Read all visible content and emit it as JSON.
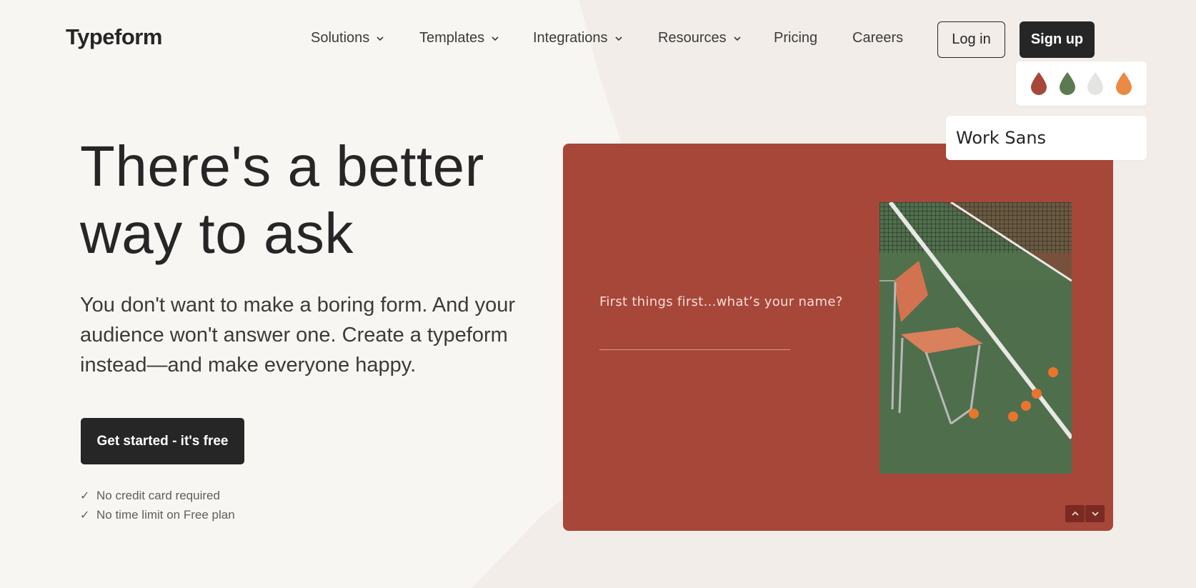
{
  "header": {
    "logo": "Typeform",
    "nav": [
      {
        "label": "Solutions",
        "dropdown": true
      },
      {
        "label": "Templates",
        "dropdown": true
      },
      {
        "label": "Integrations",
        "dropdown": true
      },
      {
        "label": "Resources",
        "dropdown": true
      },
      {
        "label": "Pricing",
        "dropdown": false
      },
      {
        "label": "Careers",
        "dropdown": false
      }
    ],
    "login_label": "Log in",
    "signup_label": "Sign up"
  },
  "hero": {
    "title_line1": "There's a better",
    "title_line2": "way to ask",
    "subtitle": "You don't want to make a boring form. And your audience won't answer one. Create a typeform instead—and make everyone happy.",
    "cta_label": "Get started - it's free",
    "checks": [
      "No credit card required",
      "No time limit on Free plan"
    ]
  },
  "preview": {
    "question": "First things first...what’s your name?",
    "colors": {
      "card_bg": "#a6473a",
      "input_line": "#d79a8e"
    },
    "photo_icon": "tennis-court-chair-photo",
    "nav_up_icon": "chevron-up-icon",
    "nav_down_icon": "chevron-down-icon"
  },
  "theme_picker": {
    "colors": [
      "#a6473a",
      "#5c7a52",
      "#e4e4e2",
      "#ea8a44"
    ],
    "font_name": "Work Sans"
  }
}
